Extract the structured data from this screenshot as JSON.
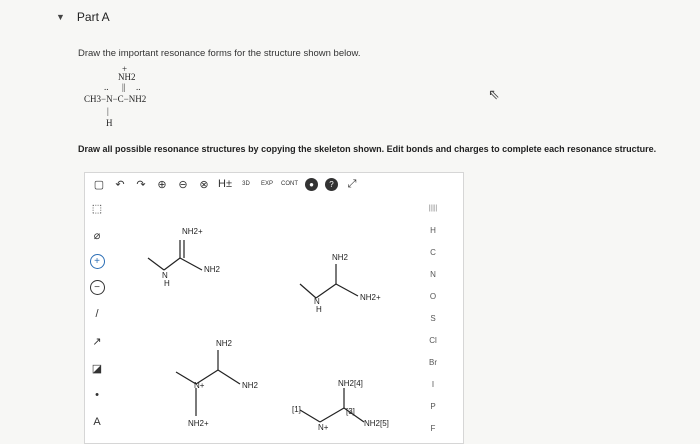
{
  "part": {
    "caret_icon": "▼",
    "title": "Part A"
  },
  "question": "Draw the important resonance forms for the structure shown below.",
  "structure": {
    "plus": "+",
    "nh2_top": "NH2",
    "dots_left": "..",
    "double_bond": "||",
    "dots_right": "..",
    "main_chain": "CH3−N−C−NH2",
    "vertical_bond": "|",
    "h_bottom": "H"
  },
  "instruction": "Draw all possible resonance structures by copying the skeleton shown. Edit bonds and charges to complete each resonance structure.",
  "toolbar": {
    "items": [
      {
        "name": "new-doc-icon",
        "glyph": "▢"
      },
      {
        "name": "undo-icon",
        "glyph": "↶"
      },
      {
        "name": "redo-icon",
        "glyph": "↷"
      },
      {
        "name": "zoom-in-icon",
        "glyph": "⊕"
      },
      {
        "name": "zoom-out-icon",
        "glyph": "⊖"
      },
      {
        "name": "zoom-fit-icon",
        "glyph": "⊗"
      },
      {
        "name": "h-toggle-icon",
        "glyph": "H±"
      },
      {
        "name": "3d-view-icon",
        "glyph": "3D"
      },
      {
        "name": "expand-icon",
        "glyph": "EXP"
      },
      {
        "name": "contract-icon",
        "glyph": "CONT"
      },
      {
        "name": "info-icon",
        "glyph": "●"
      },
      {
        "name": "help-icon",
        "glyph": "?"
      },
      {
        "name": "fullscreen-icon",
        "glyph": "⤢"
      }
    ]
  },
  "left_tools": [
    {
      "name": "select-icon",
      "glyph": "⬚"
    },
    {
      "name": "eraser-icon",
      "glyph": "⌀"
    },
    {
      "name": "positive-charge-icon",
      "glyph": "+"
    },
    {
      "name": "negative-charge-icon",
      "glyph": "−"
    },
    {
      "name": "bond-icon",
      "glyph": "/"
    },
    {
      "name": "arrow-icon",
      "glyph": "↗"
    },
    {
      "name": "ring-icon",
      "glyph": "◪"
    },
    {
      "name": "lone-pair-icon",
      "glyph": "•"
    },
    {
      "name": "atom-label-icon",
      "glyph": "A"
    }
  ],
  "periodic": {
    "top": "|||||",
    "elements": [
      "H",
      "C",
      "N",
      "O",
      "S",
      "Cl",
      "Br",
      "I",
      "P",
      "F"
    ]
  },
  "canvas_labels": {
    "nh2_plus": "NH2+",
    "nh2": "NH2",
    "n": "N",
    "h": "H",
    "n_plus": "N+",
    "map_nh2_4": "NH2[4]",
    "map_nh2_5": "NH2[5]",
    "map1": "[1]",
    "map3": "[3]"
  }
}
